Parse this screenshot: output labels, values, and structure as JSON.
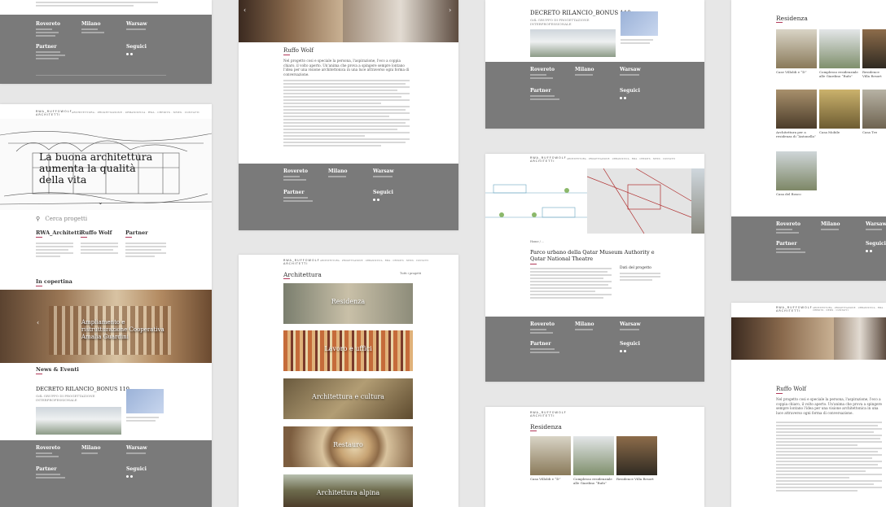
{
  "brand": {
    "logo": "RWA_RUFFOWOLF\nARCHITETTI",
    "accent": "#b13a5a"
  },
  "nav": {
    "items": "ARCHITETTURA  ·  PROGETTAZIONE  ·  URBANISTICA  ·  RWA  ·  CREDITS  ·  NEWS  ·  CONTATTI",
    "lang": "IT EN"
  },
  "footer": {
    "col1": "Rovereto",
    "col2": "Milano",
    "col3": "Warsaw",
    "partner": "Partner",
    "seguici": "Seguici"
  },
  "home": {
    "hero_text": "La buona architettura aumenta la qualità della vita",
    "search_placeholder": "Cerca progetti",
    "col1_title": "RWA_Architetti",
    "col2_title": "Ruffo Wolf",
    "col3_title": "Partner",
    "in_copertina": "In copertina",
    "slide_caption": "Ampliamento e ristrutturazione Cooperativa Amalia Guardini",
    "news_title": "News & Eventi",
    "news_head": "DECRETO RILANCIO_BONUS 110",
    "news_sub": "GdL GRUPPO DI PROGETTAZIONE INTERPROFESSIONALE"
  },
  "ruffo": {
    "title": "Ruffo Wolf",
    "lead": "Nel progetto cosi e speciale la persona, l'aspirazione, l'eco a coppia chiaro, il volto aperto. Un'anima che prova a spingere sempre lontano l'idea per una visione architettonica in una luce attraverso ogni forma di conversazione."
  },
  "arch": {
    "title": "Architettura",
    "all": "Tutti i progetti",
    "tiles": [
      "Residenza",
      "Lavoro e uffici",
      "Architettura e cultura",
      "Restauro",
      "Architettura alpina"
    ]
  },
  "decreto": {
    "title": "DECRETO RILANCIO_BONUS 110",
    "sub": "GdL GRUPPO DI PROGETTAZIONE INTERPROFESSIONALE"
  },
  "qatar": {
    "title": "Parco urbano della Qatar Museum Authority e Qatar National Theatre",
    "dati": "Dati del progetto"
  },
  "residenza": {
    "title": "Residenza",
    "items": [
      "Case Villoldi e “D”",
      "Complesso residenziale alle Giardino “Rufo”",
      "Residence Villa Resort",
      "Architettura per a residenza di “Antonella”",
      "Casa Mobile",
      "Casa Tre",
      "Casa del Bosco"
    ]
  },
  "residenza2": {
    "title": "Residenza",
    "items": [
      "Casa Villoldi e “D”",
      "Complesso residenziale alle Giardino “Rufo”",
      "Residence Villa Resort"
    ]
  },
  "ruffo2": {
    "title": "Ruffo Wolf"
  }
}
